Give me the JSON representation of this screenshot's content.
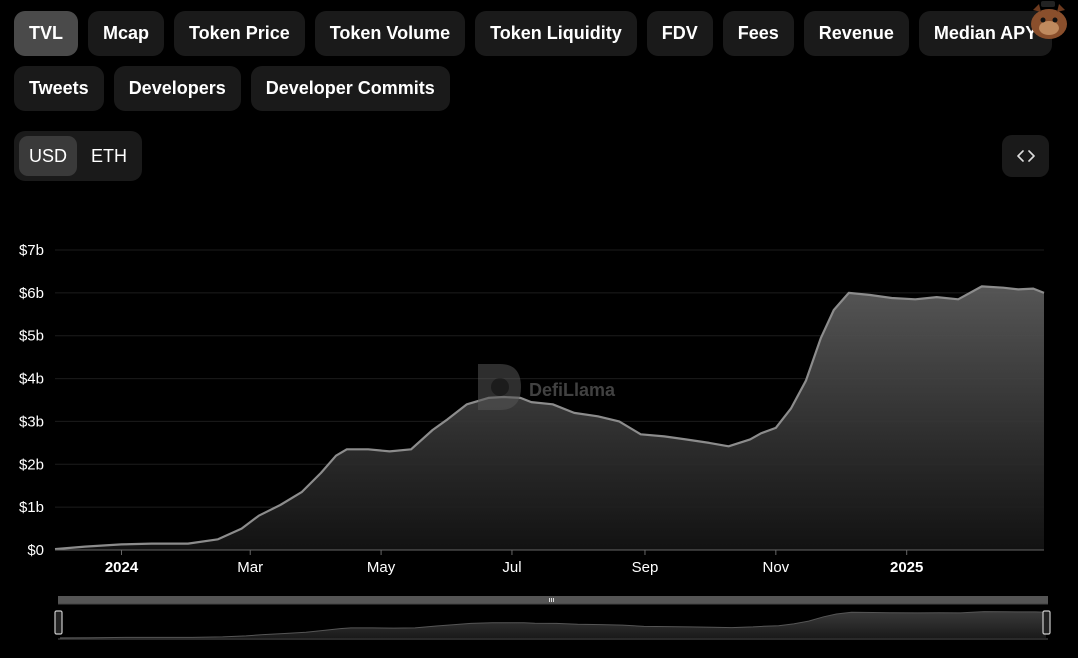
{
  "metric_tabs": {
    "row1": [
      {
        "label": "TVL",
        "active": true
      },
      {
        "label": "Mcap"
      },
      {
        "label": "Token Price"
      },
      {
        "label": "Token Volume"
      },
      {
        "label": "Token Liquidity"
      },
      {
        "label": "FDV"
      },
      {
        "label": "Fees"
      },
      {
        "label": "Revenue"
      },
      {
        "label": "Median APY"
      }
    ],
    "row2": [
      {
        "label": "Tweets"
      },
      {
        "label": "Developers"
      },
      {
        "label": "Developer Commits"
      }
    ]
  },
  "currency": {
    "options": [
      "USD",
      "ETH"
    ],
    "selected": "USD"
  },
  "embed_icon": "code-brackets-icon",
  "watermark": "DefiLlama",
  "colors": {
    "background": "#000000",
    "line": "#8c8c8c",
    "pill": "#1a1a1a",
    "pill_active": "#4a4a4a"
  },
  "chart_data": {
    "type": "area",
    "title": "",
    "xlabel": "",
    "ylabel": "",
    "series": [
      {
        "x": [
          "2023-12-01",
          "2023-12-15",
          "2024-01-01",
          "2024-01-15",
          "2024-02-01",
          "2024-02-15",
          "2024-02-26",
          "2024-03-05",
          "2024-03-15",
          "2024-03-25",
          "2024-04-03",
          "2024-04-10",
          "2024-04-15",
          "2024-04-25",
          "2024-05-05",
          "2024-05-15",
          "2024-05-25",
          "2024-06-01",
          "2024-06-10",
          "2024-06-20",
          "2024-06-27",
          "2024-07-05",
          "2024-07-10",
          "2024-07-20",
          "2024-07-30",
          "2024-08-10",
          "2024-08-20",
          "2024-08-30",
          "2024-09-10",
          "2024-09-20",
          "2024-10-01",
          "2024-10-10",
          "2024-10-20",
          "2024-10-25",
          "2024-11-01",
          "2024-11-08",
          "2024-11-15",
          "2024-11-22",
          "2024-11-28",
          "2024-12-05",
          "2024-12-15",
          "2024-12-25",
          "2025-01-05",
          "2025-01-15",
          "2025-01-25",
          "2025-02-05",
          "2025-02-15",
          "2025-02-22",
          "2025-03-01",
          "2025-03-06"
        ],
        "values": [
          0.02,
          0.08,
          0.13,
          0.15,
          0.15,
          0.25,
          0.5,
          0.8,
          1.05,
          1.35,
          1.8,
          2.2,
          2.35,
          2.35,
          2.3,
          2.35,
          2.8,
          3.05,
          3.4,
          3.55,
          3.57,
          3.55,
          3.45,
          3.4,
          3.2,
          3.12,
          3.0,
          2.7,
          2.65,
          2.58,
          2.5,
          2.42,
          2.58,
          2.72,
          2.85,
          3.3,
          3.95,
          4.95,
          5.6,
          6.0,
          5.95,
          5.88,
          5.85,
          5.9,
          5.85,
          6.15,
          6.12,
          6.08,
          6.1,
          6.0
        ]
      }
    ],
    "y_ticks": [
      "$0",
      "$1b",
      "$2b",
      "$3b",
      "$4b",
      "$5b",
      "$6b",
      "$7b"
    ],
    "ylim": [
      0,
      7
    ],
    "x_ticks": [
      {
        "label": "2024",
        "date": "2024-01-01",
        "bold": true
      },
      {
        "label": "Mar",
        "date": "2024-03-01"
      },
      {
        "label": "May",
        "date": "2024-05-01"
      },
      {
        "label": "Jul",
        "date": "2024-07-01"
      },
      {
        "label": "Sep",
        "date": "2024-09-01"
      },
      {
        "label": "Nov",
        "date": "2024-11-01"
      },
      {
        "label": "2025",
        "date": "2025-01-01",
        "bold": true
      }
    ],
    "xlim": [
      "2023-12-01",
      "2025-03-06"
    ],
    "grid": true
  }
}
